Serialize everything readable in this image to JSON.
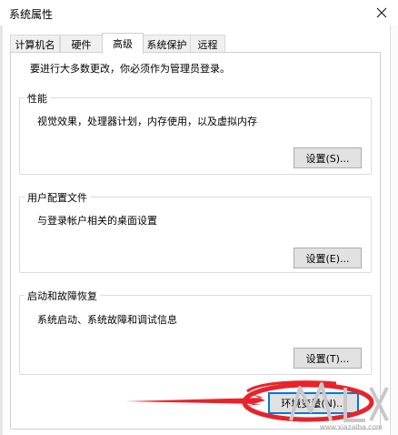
{
  "window": {
    "title": "系统属性"
  },
  "tabs": [
    {
      "label": "计算机名"
    },
    {
      "label": "硬件"
    },
    {
      "label": "高级"
    },
    {
      "label": "系统保护"
    },
    {
      "label": "远程"
    }
  ],
  "advanced": {
    "notice": "要进行大多数更改，你必须作为管理员登录。",
    "performance": {
      "title": "性能",
      "description": "视觉效果，处理器计划，内存使用，以及虚拟内存",
      "button": "设置(S)..."
    },
    "user_profiles": {
      "title": "用户配置文件",
      "description": "与登录帐户相关的桌面设置",
      "button": "设置(E)..."
    },
    "startup_recovery": {
      "title": "启动和故障恢复",
      "description": "系统启动、系统故障和调试信息",
      "button": "设置(T)..."
    },
    "env_button": "环境变量(N)..."
  },
  "watermark": {
    "url": "www.xiazaiba.com"
  },
  "colors": {
    "annotation_red": "#e8232b",
    "focus_blue": "#0078d7",
    "button_face": "#e1e1e1"
  }
}
